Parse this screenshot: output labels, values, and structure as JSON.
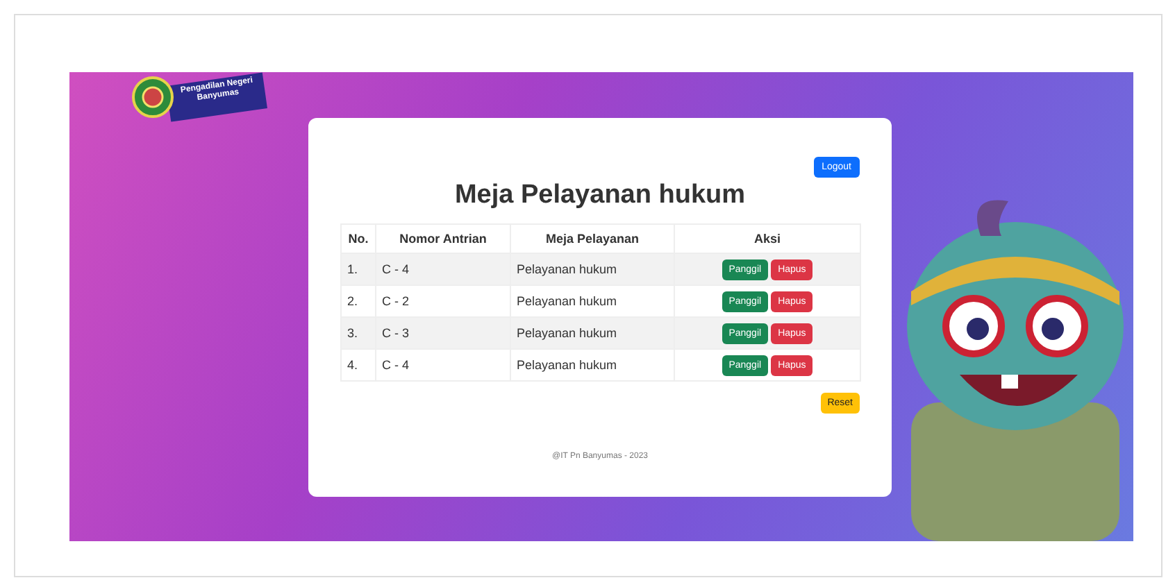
{
  "logo": {
    "title": "Pengadilan Negeri",
    "subtitle": "Banyumas"
  },
  "card": {
    "logout_button": "Logout",
    "title": "Meja Pelayanan hukum",
    "table": {
      "columns": [
        "No.",
        "Nomor Antrian",
        "Meja Pelayanan",
        "Aksi"
      ],
      "rows": [
        {
          "no": "1.",
          "queue": "C - 4",
          "desk": "Pelayanan hukum",
          "call_button": "Panggil",
          "delete_button": "Hapus"
        },
        {
          "no": "2.",
          "queue": "C - 2",
          "desk": "Pelayanan hukum",
          "call_button": "Panggil",
          "delete_button": "Hapus"
        },
        {
          "no": "3.",
          "queue": "C - 3",
          "desk": "Pelayanan hukum",
          "call_button": "Panggil",
          "delete_button": "Hapus"
        },
        {
          "no": "4.",
          "queue": "C - 4",
          "desk": "Pelayanan hukum",
          "call_button": "Panggil",
          "delete_button": "Hapus"
        }
      ]
    },
    "reset_button": "Reset",
    "footer": "@IT Pn Banyumas - 2023"
  }
}
